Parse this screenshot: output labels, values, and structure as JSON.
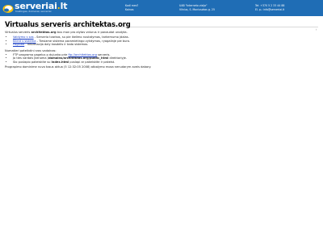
{
  "header": {
    "logo_text": "serveriai",
    "logo_dot": ".",
    "logo_tld": "lt",
    "logo_sub": "hostingas, domenai, serveriai",
    "col1": [
      "Kodl mes?",
      "Kainos"
    ],
    "col2": [
      "UAB \"Interneto vizija\"",
      "Vilnius, S. Moniuszkos g. 25"
    ],
    "col3": [
      "Tel: +370 5 2 33 44 88",
      "El. p.: info@serveriai.lt"
    ]
  },
  "corner_mark": "↑",
  "page": {
    "title": "Virtualus serveris architektas.org",
    "intro_prefix": "Virtualus serveris ",
    "intro_domain": "architektas.org",
    "intro_suffix": " bus mon pro alytas vidurus ir panaudot urodyta.",
    "links": [
      {
        "label": "Valdymo s sas",
        "desc": " - Serverio tvarkos, su pie ikelimo nustatymas, tarkemumo jdalas."
      },
      {
        "label": "Klient s sistema",
        "desc": " - Tiesiame sistema paramietingo vykdymas, ryagalinje pie buro."
      },
      {
        "label": "Pagalba",
        "desc": " - Informacija daly kasdelis ir tada sistemos."
      }
    ],
    "notes_title": "Numatieri pateikdini sros vadainas:",
    "notes": [
      {
        "prefix": "FTP programa pagelus p dujunko prie ",
        "link": "ftp://architektas.org",
        "suffix": " serveris."
      },
      {
        "prefix": "Jo ties vardais jkenoma ",
        "bold": "/domains/architektas.org/public_html",
        "suffix": " direktoriyje."
      },
      {
        "prefix": "Sio puslapio pakeiskite su ",
        "bold": "index.html",
        "suffix": " puslapi ar pakeiskite ir pakeist."
      }
    ],
    "footer_note": "Prograpimo dominime nuvo tosus aktua (5 12:32:05 2008) atbalymo mosa nenudarym aveis dabary."
  }
}
